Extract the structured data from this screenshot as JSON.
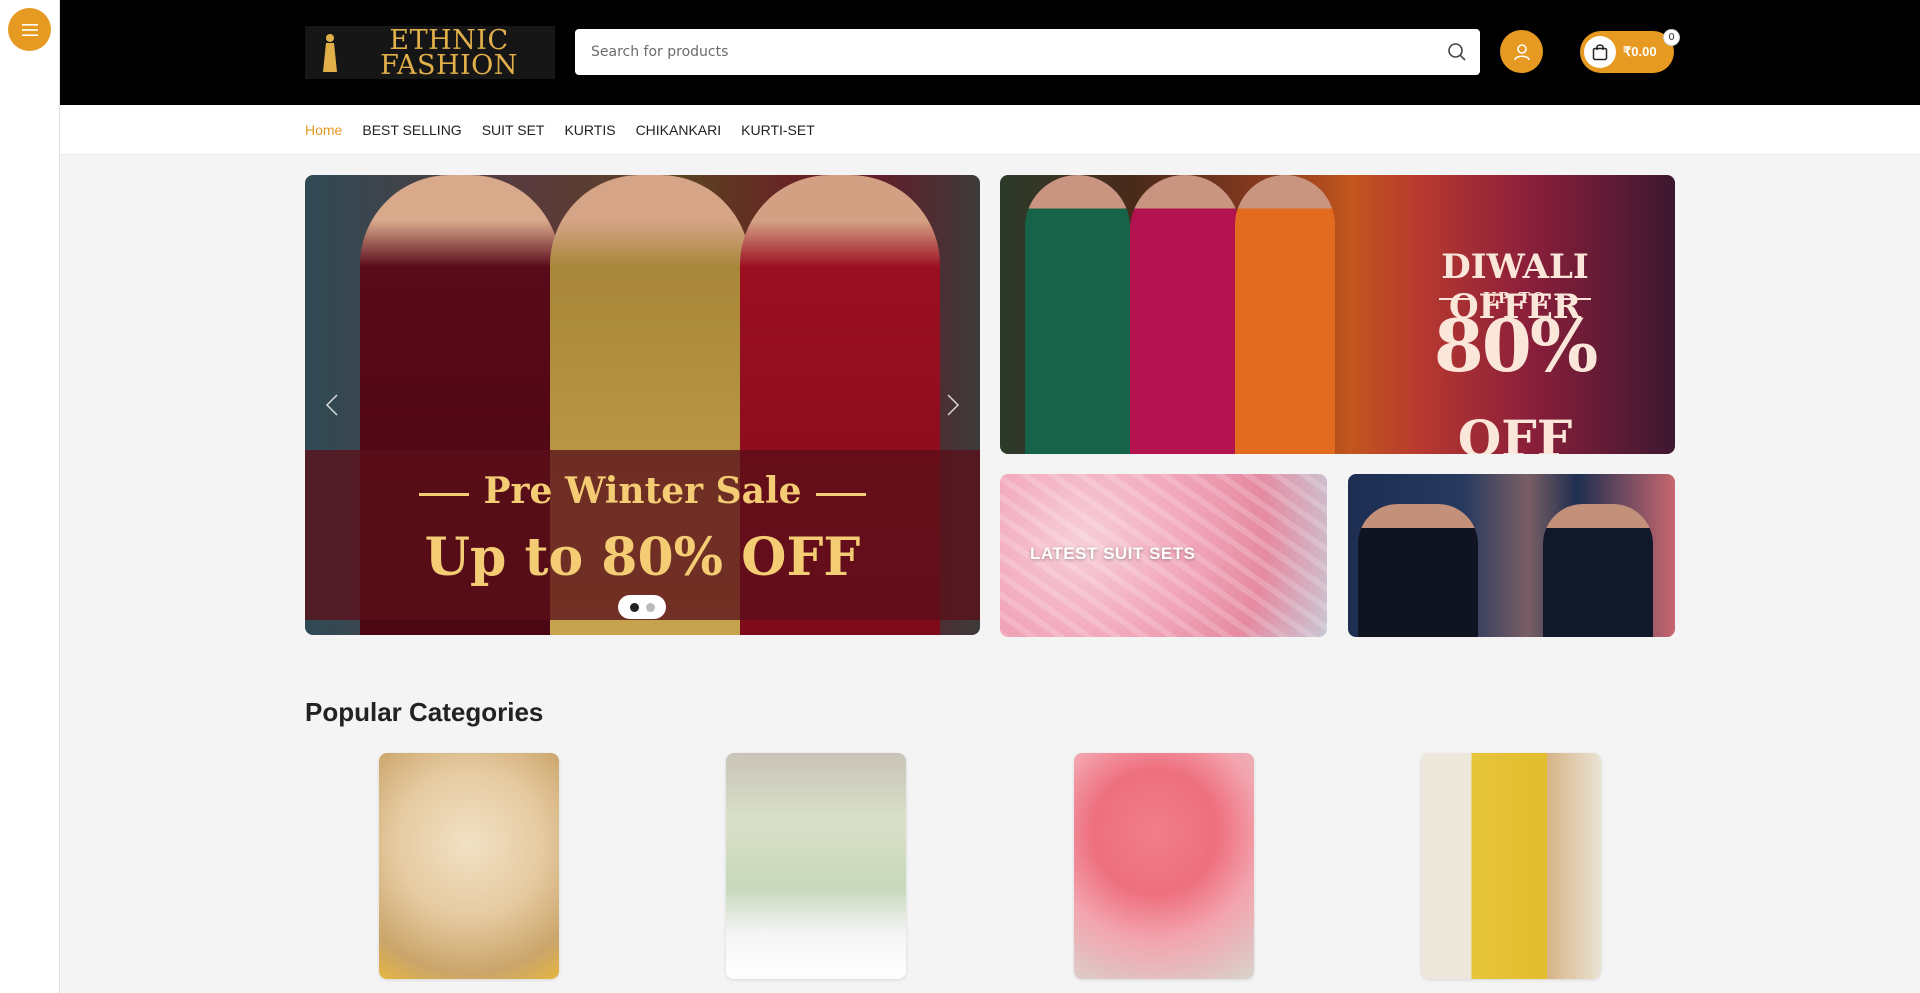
{
  "brand": {
    "line1": "ETHNIC",
    "line2": "FASHION"
  },
  "search": {
    "placeholder": "Search for products"
  },
  "cart": {
    "total": "₹0.00",
    "count": "0"
  },
  "nav": {
    "items": [
      {
        "label": "Home",
        "active": true
      },
      {
        "label": "BEST SELLING"
      },
      {
        "label": "SUIT SET"
      },
      {
        "label": "KURTIS"
      },
      {
        "label": "CHIKANKARI"
      },
      {
        "label": "KURTI-SET"
      }
    ]
  },
  "hero": {
    "title": "Pre Winter Sale",
    "subtitle": "Up to 80% OFF",
    "slide_count": 2,
    "active_slide": 1
  },
  "diwali": {
    "line1": "DIWALI OFFER",
    "line2": "UP TO",
    "line3": "80%",
    "line3b": "OFF"
  },
  "suits_banner": {
    "label": "LATEST SUIT SETS"
  },
  "categories": {
    "title": "Popular Categories"
  },
  "colors": {
    "accent": "#e69a22",
    "header_bg": "#000000",
    "gold": "#e2b04b"
  },
  "icons": {
    "menu": "hamburger-icon",
    "search": "search-icon",
    "account": "user-icon",
    "cart": "shopping-bag-icon"
  }
}
